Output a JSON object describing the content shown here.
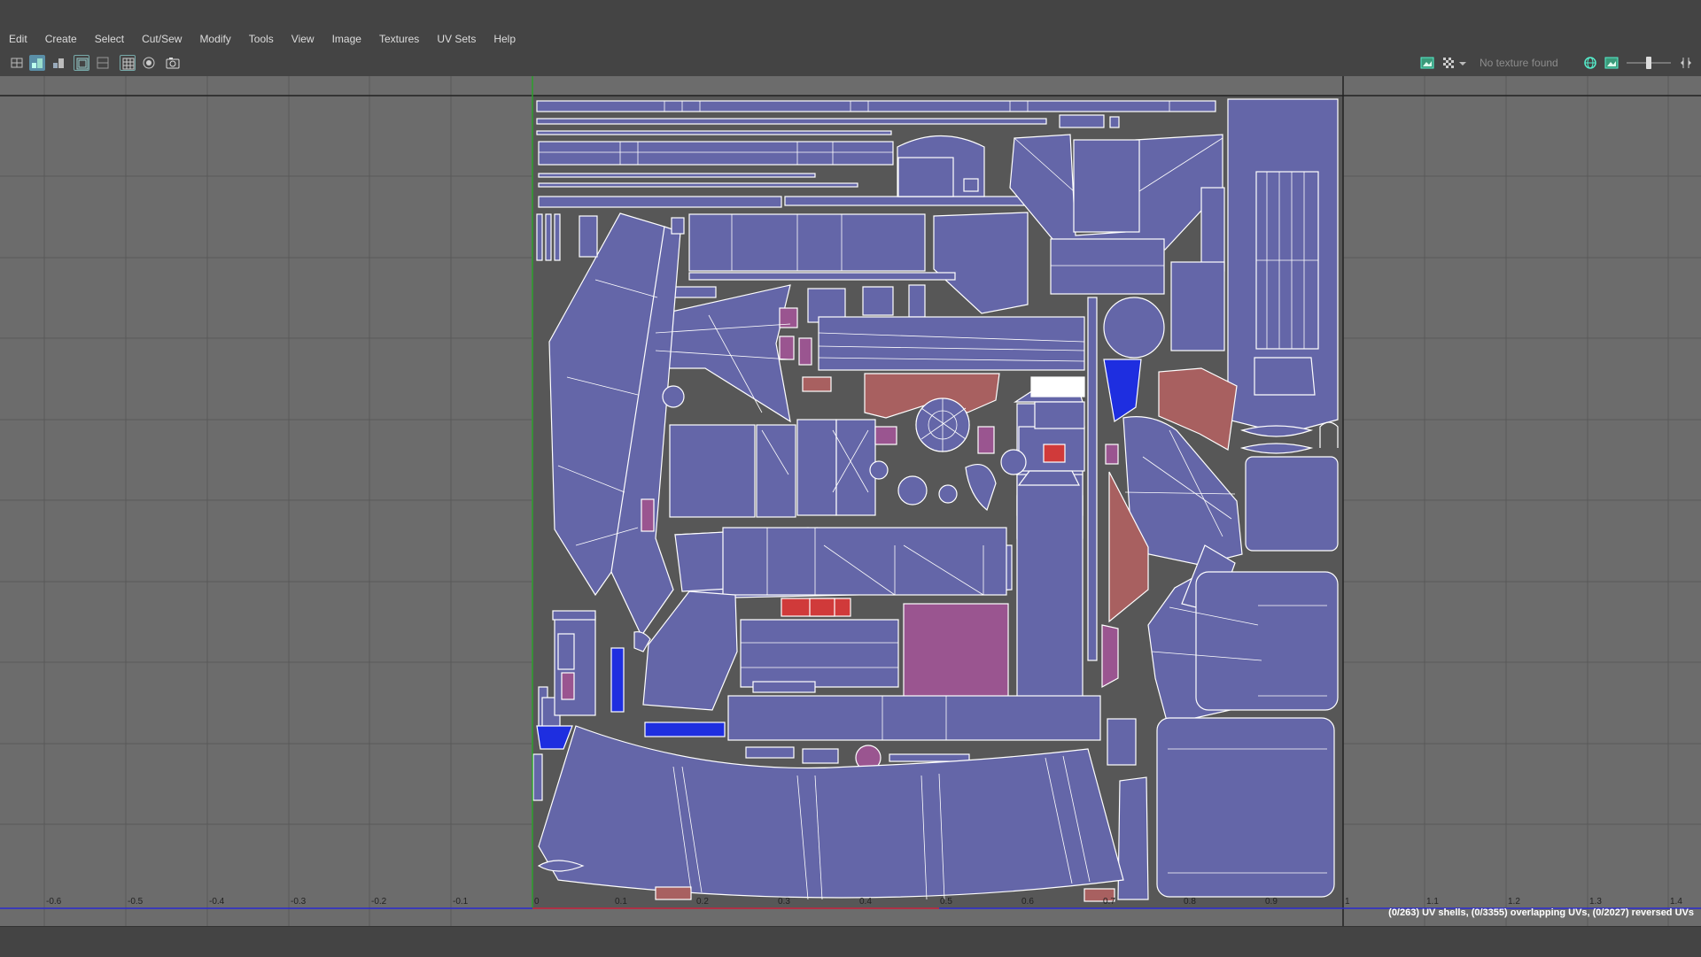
{
  "menu": {
    "items": [
      "Edit",
      "Create",
      "Select",
      "Cut/Sew",
      "Modify",
      "Tools",
      "View",
      "Image",
      "Textures",
      "UV Sets",
      "Help"
    ]
  },
  "toolbar": {
    "texture_status": "No texture found",
    "left_icons": [
      "uv-shell-icon",
      "uv-toggle-icon",
      "uv-isolate-icon",
      "uv-grid-icon",
      "uv-grid-alt-icon",
      "checker-icon",
      "shaded-icon",
      "snapshot-icon"
    ],
    "right_icons": [
      "image-display-icon",
      "checker-pattern-icon",
      "dropdown-icon",
      "globe-icon",
      "image-icon",
      "exposure-slider",
      "gamma-icon"
    ]
  },
  "viewport": {
    "axis_labels_x": [
      "-0.6",
      "-0.5",
      "-0.4",
      "-0.3",
      "-0.2",
      "-0.1",
      "0",
      "0.1",
      "0.2",
      "0.3",
      "0.4",
      "0.5",
      "0.6",
      "0.7",
      "0.8",
      "0.9",
      "1",
      "1.1",
      "1.2",
      "1.3",
      "1.4"
    ],
    "colors": {
      "background": "#6c6c6c",
      "grid": "#5a5a5a",
      "uv_shell_fill": "#6466a8",
      "uv_shell_stroke": "#ffffff",
      "uv_shell_pink": "#9a5590",
      "uv_shell_red": "#d03a3a",
      "uv_shell_rose": "#a86060",
      "uv_shell_blue": "#1e2ee0",
      "uv_space_bg": "#575757",
      "u_axis": "#2b2bd0",
      "v_axis": "#2ba02b",
      "u_axis_red": "#d02b2b"
    }
  },
  "status": {
    "uv_stats": "(0/263) UV shells, (0/3355) overlapping UVs, (0/2027) reversed UVs"
  }
}
